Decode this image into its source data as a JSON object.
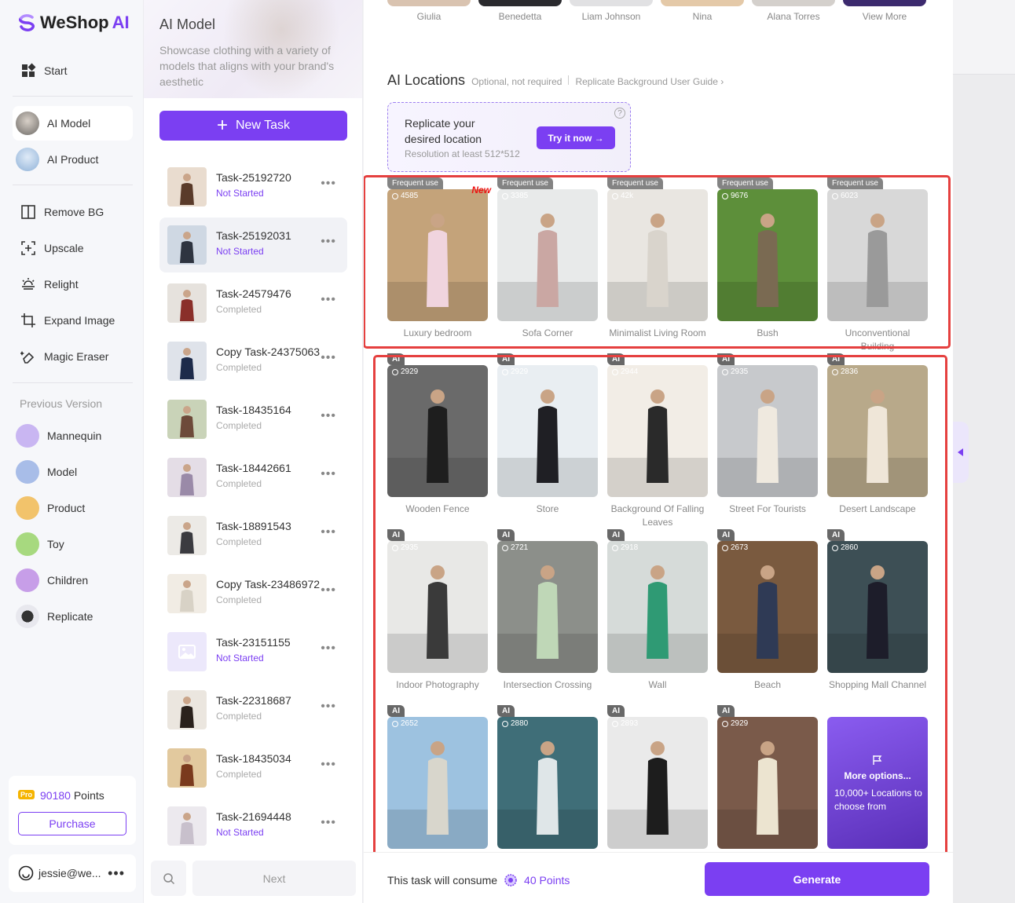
{
  "brand": {
    "name_a": "WeShop",
    "name_b": "AI"
  },
  "sidebar": {
    "top_items": [
      {
        "label": "Start",
        "icon": "grid-icon"
      },
      {
        "label": "AI Model",
        "icon": "ai-model-avatar"
      },
      {
        "label": "AI Product",
        "icon": "ai-product-avatar"
      },
      {
        "label": "Remove BG",
        "icon": "remove-bg-icon"
      },
      {
        "label": "Upscale",
        "icon": "upscale-icon"
      },
      {
        "label": "Relight",
        "icon": "relight-icon"
      },
      {
        "label": "Expand Image",
        "icon": "expand-icon"
      },
      {
        "label": "Magic Eraser",
        "icon": "magic-eraser-icon"
      }
    ],
    "previous_version_label": "Previous Version",
    "prev_items": [
      {
        "label": "Mannequin",
        "color": "#c9b6f2"
      },
      {
        "label": "Model",
        "color": "#a8bde8"
      },
      {
        "label": "Product",
        "color": "#f2c36b"
      },
      {
        "label": "Toy",
        "color": "#a7d97f"
      },
      {
        "label": "Children",
        "color": "#c79ee8"
      },
      {
        "label": "Replicate",
        "color": "#e8e8ee"
      }
    ],
    "points": {
      "badge": "Pro",
      "value": "90180",
      "unit": "Points"
    },
    "purchase_label": "Purchase",
    "user": {
      "email": "jessie@we..."
    }
  },
  "tasks": {
    "title": "AI Model",
    "description": "Showcase clothing with a variety of models that aligns with your brand's aesthetic",
    "new_task_label": "New Task",
    "items": [
      {
        "name": "Task-25192720",
        "status": "Not Started",
        "ns": true
      },
      {
        "name": "Task-25192031",
        "status": "Not Started",
        "ns": true,
        "selected": true
      },
      {
        "name": "Task-24579476",
        "status": "Completed"
      },
      {
        "name": "Copy Task-24375063",
        "status": "Completed"
      },
      {
        "name": "Task-18435164",
        "status": "Completed"
      },
      {
        "name": "Task-18442661",
        "status": "Completed"
      },
      {
        "name": "Task-18891543",
        "status": "Completed"
      },
      {
        "name": "Copy Task-23486972",
        "status": "Completed"
      },
      {
        "name": "Task-23151155",
        "status": "Not Started",
        "ns": true
      },
      {
        "name": "Task-22318687",
        "status": "Completed"
      },
      {
        "name": "Task-18435034",
        "status": "Completed"
      },
      {
        "name": "Task-21694448",
        "status": "Not Started",
        "ns": true
      }
    ],
    "next_label": "Next"
  },
  "models": [
    "Giulia",
    "Benedetta",
    "Liam Johnson",
    "Nina",
    "Alana Torres",
    "View More"
  ],
  "locations": {
    "title": "AI Locations",
    "optional": "Optional, not required",
    "guide": "Replicate Background User Guide ›",
    "replicate": {
      "title": "Replicate your desired location",
      "sub": "Resolution at least 512*512",
      "btn": "Try it now →"
    },
    "frequent_tag": "Frequent use",
    "new_tag": "New",
    "ai_tag": "AI",
    "frequent": [
      {
        "label": "Luxury bedroom",
        "count": "4585",
        "new": true
      },
      {
        "label": "Sofa Corner",
        "count": "3385"
      },
      {
        "label": "Minimalist Living Room",
        "count": "42k"
      },
      {
        "label": "Bush",
        "count": "9676"
      },
      {
        "label": "Unconventional Building",
        "count": "6023"
      }
    ],
    "ai": [
      {
        "label": "Wooden Fence",
        "count": "2929"
      },
      {
        "label": "Store",
        "count": "2929"
      },
      {
        "label": "Background Of Falling Leaves",
        "count": "2944"
      },
      {
        "label": "Street For Tourists",
        "count": "2935"
      },
      {
        "label": "Desert Landscape",
        "count": "2836"
      },
      {
        "label": "Indoor Photography",
        "count": "2935"
      },
      {
        "label": "Intersection Crossing",
        "count": "2721"
      },
      {
        "label": "Wall",
        "count": "2918"
      },
      {
        "label": "Beach",
        "count": "2673"
      },
      {
        "label": "Shopping Mall Channel",
        "count": "2860"
      },
      {
        "label": "",
        "count": "2652"
      },
      {
        "label": "",
        "count": "2880"
      },
      {
        "label": "",
        "count": "2893"
      },
      {
        "label": "",
        "count": "2929"
      }
    ],
    "more": {
      "title": "More options...",
      "sub": "10,000+ Locations to choose from"
    }
  },
  "footer": {
    "consume_text": "This task will consume",
    "points": "40 Points",
    "generate_label": "Generate"
  },
  "colors": {
    "accent": "#7b3ff2",
    "highlight": "#e5403f"
  }
}
